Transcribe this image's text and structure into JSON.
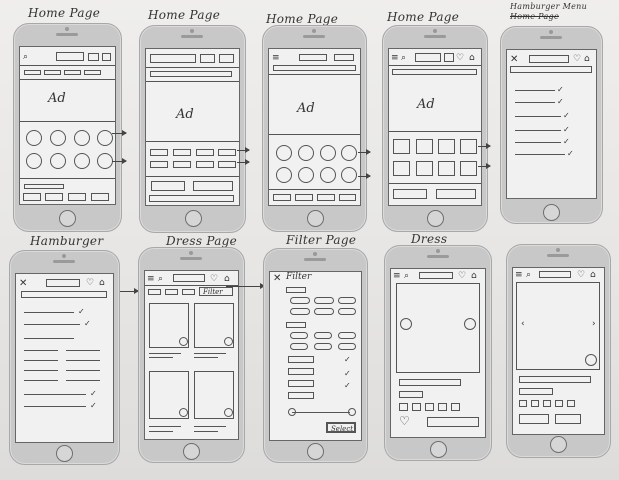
{
  "labels": {
    "p1": "Home Page",
    "p2": "Home Page",
    "p3": "Home Page",
    "p4": "Home Page",
    "p5a": "Hamburger Menu",
    "p5b": "Home Page",
    "p6": "Hamburger",
    "p7": "Dress Page",
    "p8": "Filter Page",
    "p9": "Dress"
  },
  "ad_text": "Ad",
  "filter_title": "Filter",
  "filter_button_label": "Filter",
  "select_button_label": "Select",
  "icons": {
    "close": "close-icon",
    "search": "search-icon",
    "heart": "heart-icon",
    "bag": "shopping-bag-icon",
    "menu": "hamburger-icon",
    "check": "checkmark-icon",
    "chevron_left": "chevron-left-icon",
    "chevron_right": "chevron-right-icon"
  }
}
